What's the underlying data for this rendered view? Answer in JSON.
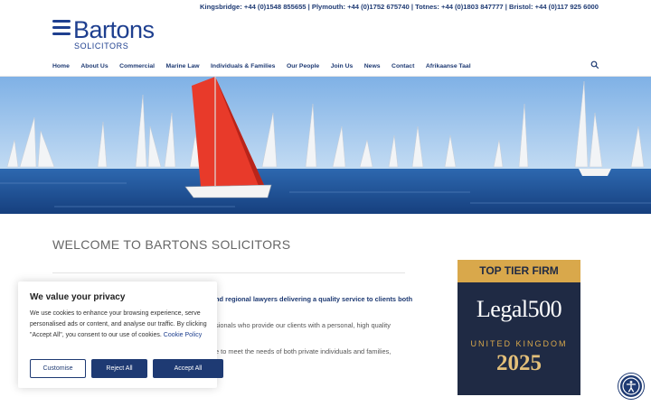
{
  "topbar": {
    "contacts": "Kingsbridge: +44 (0)1548 855655 | Plymouth: +44 (0)1752 675740 | Totnes: +44 (0)1803 847777 | Bristol: +44 (0)117 925 6000"
  },
  "logo": {
    "brand": "Bartons",
    "sub": "SOLICITORS"
  },
  "nav": {
    "items": [
      "Home",
      "About Us",
      "Commercial",
      "Marine Law",
      "Individuals & Families",
      "Our People",
      "Join Us",
      "News",
      "Contact",
      "Afrikaanse Taal"
    ],
    "search_icon": "search-icon"
  },
  "main": {
    "welcome": "WELCOME TO BARTONS SOLICITORS",
    "paragraph_1": "nd regional lawyers delivering a quality service to clients both",
    "paragraph_2": "sionals who provide our clients with a personal, high quality",
    "paragraph_3": "e to meet the needs of both private individuals and families,"
  },
  "award": {
    "banner": "TOP TIER FIRM",
    "brand": "Legal500",
    "region": "UNITED KINGDOM",
    "year": "2025"
  },
  "cookie": {
    "title": "We value your privacy",
    "text": "We use cookies to enhance your browsing experience, serve personalised ads or content, and analyse our traffic. By clicking \"Accept All\", you consent to our use of cookies.",
    "policy_link": "Cookie Policy",
    "customise": "Customise",
    "reject": "Reject All",
    "accept": "Accept All"
  },
  "colors": {
    "navy": "#1e3a73",
    "gold": "#d9a84b",
    "sea": "#1f4f8f",
    "sky": "#9cc3ea"
  }
}
